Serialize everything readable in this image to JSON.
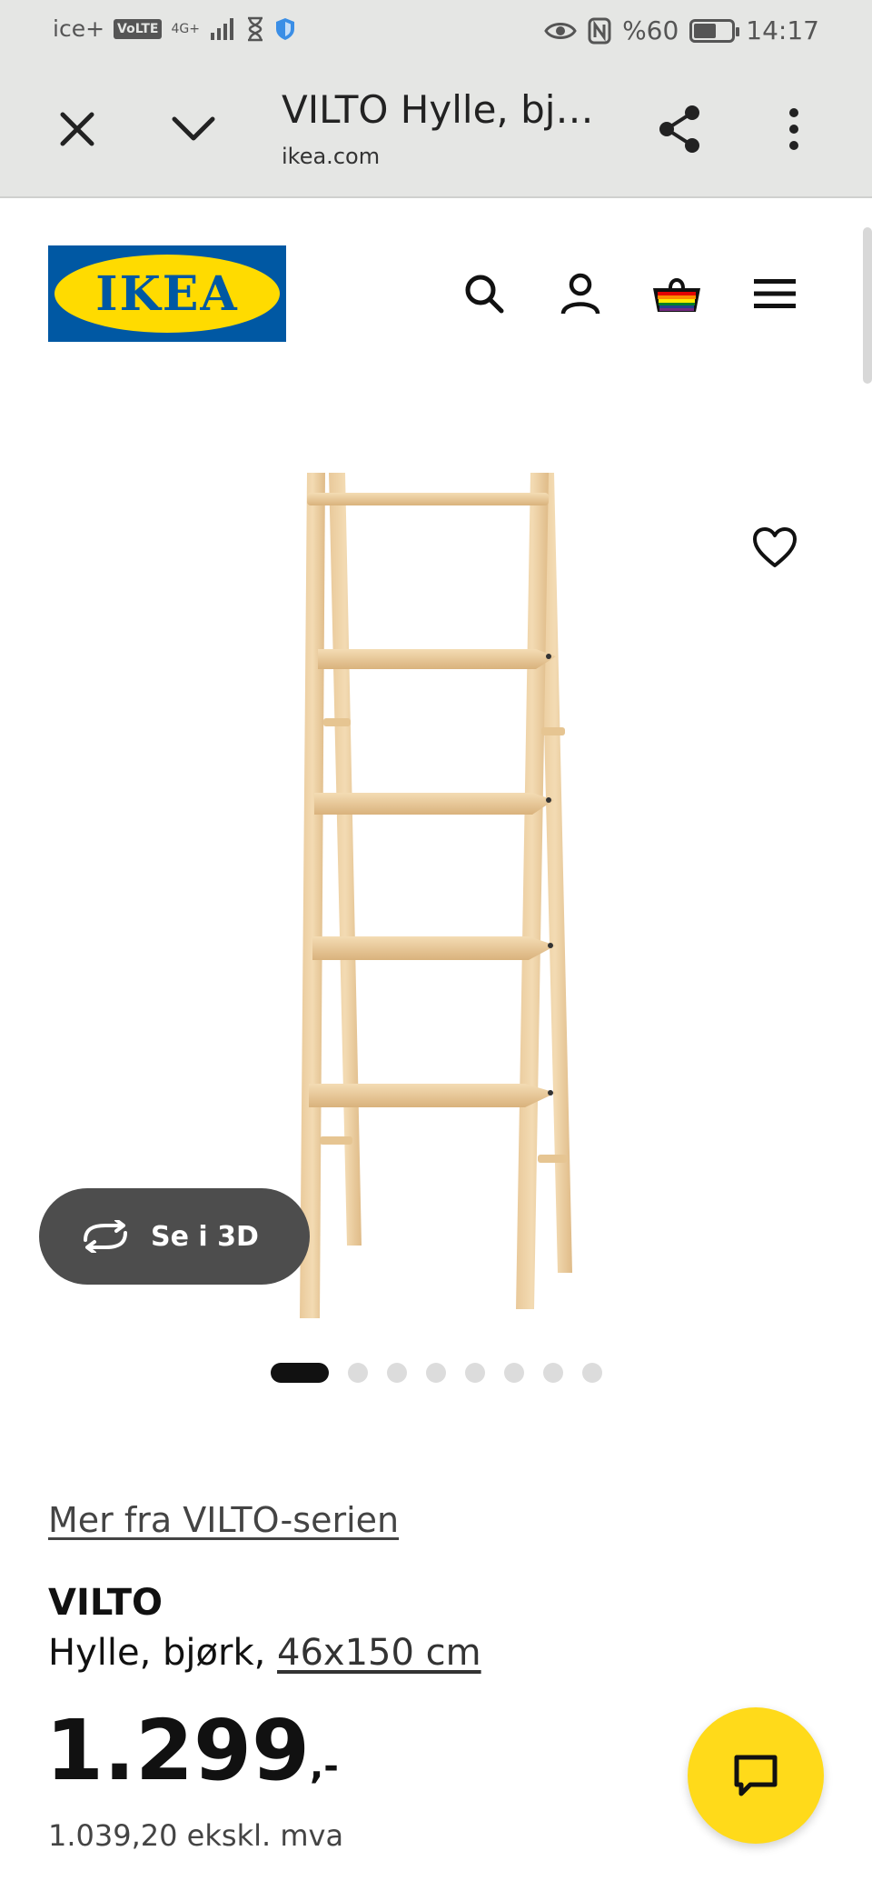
{
  "status_bar": {
    "carrier": "ice+",
    "volte": "VoLTE",
    "network": "4G+",
    "battery": "%60",
    "time": "14:17",
    "battery_level": 0.6
  },
  "browser": {
    "title": "VILTO Hylle, bj…",
    "domain": "ikea.com",
    "icons": [
      "close-icon",
      "chevron-down-icon",
      "share-icon",
      "more-vert-icon"
    ]
  },
  "header": {
    "logo_text": "IKEA",
    "icons": [
      "search-icon",
      "profile-icon",
      "shopping-bag-icon",
      "menu-icon"
    ],
    "colors": {
      "brand_blue": "#0058a3",
      "brand_yellow": "#ffdb00"
    }
  },
  "gallery": {
    "view3d_label": "Se i 3D",
    "dot_count": 8,
    "active_index": 0
  },
  "product": {
    "series_link": "Mer fra VILTO-serien",
    "name": "VILTO",
    "desc_prefix": "Hylle, bjørk, ",
    "dimensions": "46x150 cm",
    "price": "1.299",
    "price_suffix": ",-",
    "price_ex_vat": "1.039,20 ekskl. mva"
  }
}
